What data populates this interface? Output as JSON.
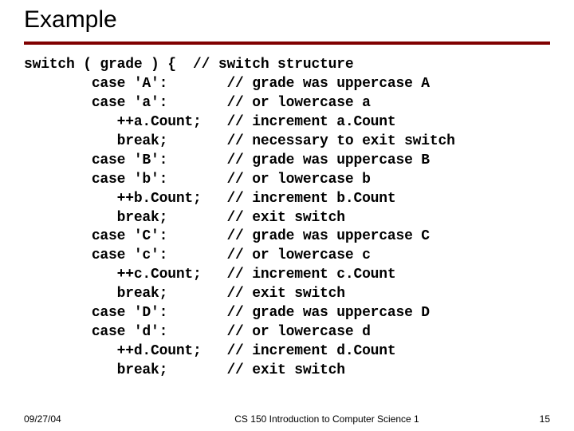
{
  "title": "Example",
  "code_lines": [
    "switch ( grade ) {  // switch structure",
    "        case 'A':       // grade was uppercase A",
    "        case 'a':       // or lowercase a",
    "           ++a.Count;   // increment a.Count",
    "           break;       // necessary to exit switch",
    "        case 'B':       // grade was uppercase B",
    "        case 'b':       // or lowercase b",
    "           ++b.Count;   // increment b.Count",
    "           break;       // exit switch",
    "        case 'C':       // grade was uppercase C",
    "        case 'c':       // or lowercase c",
    "           ++c.Count;   // increment c.Count",
    "           break;       // exit switch",
    "        case 'D':       // grade was uppercase D",
    "        case 'd':       // or lowercase d",
    "           ++d.Count;   // increment d.Count",
    "           break;       // exit switch"
  ],
  "footer": {
    "date": "09/27/04",
    "course": "CS 150 Introduction to Computer Science 1",
    "page": "15"
  }
}
